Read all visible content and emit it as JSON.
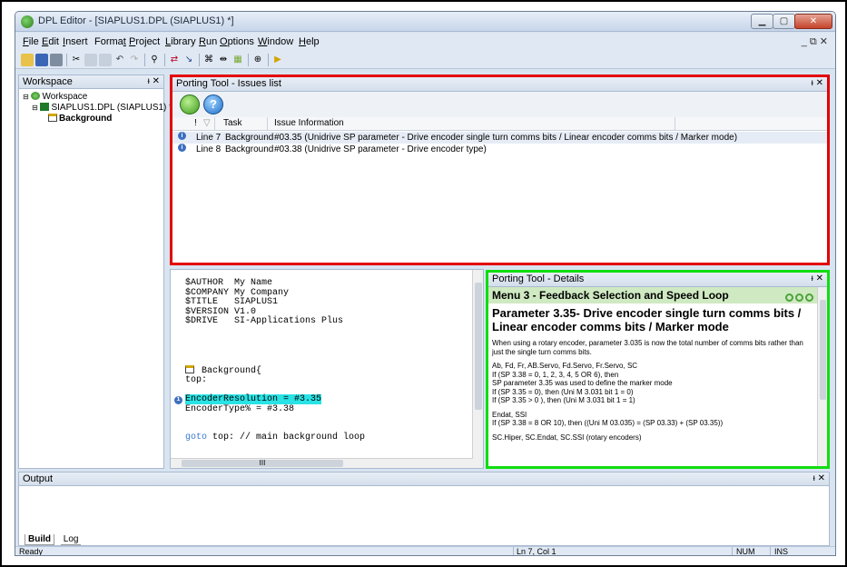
{
  "window": {
    "title": "DPL Editor - [SIAPLUS1.DPL (SIAPLUS1) *]"
  },
  "menu": [
    {
      "label": "File",
      "u": "F",
      "rest": "ile"
    },
    {
      "label": "Edit",
      "u": "E",
      "rest": "dit"
    },
    {
      "label": "Insert",
      "u": "I",
      "rest": "nsert"
    },
    {
      "label": "Format",
      "pre": "Forma",
      "u": "t",
      "rest": ""
    },
    {
      "label": "Project",
      "u": "P",
      "rest": "roject"
    },
    {
      "label": "Library",
      "u": "L",
      "rest": "ibrary"
    },
    {
      "label": "Run",
      "u": "R",
      "rest": "un"
    },
    {
      "label": "Options",
      "u": "O",
      "rest": "ptions"
    },
    {
      "label": "Window",
      "u": "W",
      "rest": "indow"
    },
    {
      "label": "Help",
      "u": "H",
      "rest": "elp"
    }
  ],
  "mdi_controls": "_ ⧉ ✕",
  "workspace": {
    "title": "Workspace",
    "pin": " ᵻ ✕",
    "tree": [
      "Workspace",
      "SIAPLUS1.DPL (SIAPLUS1) *",
      "Background"
    ]
  },
  "issues": {
    "title": "Porting Tool - Issues list",
    "columns": [
      "!",
      "Task",
      "Issue Information"
    ],
    "rows": [
      {
        "line": "Line 7",
        "task": "Background",
        "info": "#03.35 (Unidrive SP parameter - Drive encoder single turn comms bits / Linear encoder comms bits / Marker mode)"
      },
      {
        "line": "Line 8",
        "task": "Background",
        "info": "#03.38 (Unidrive SP parameter - Drive encoder type)"
      }
    ]
  },
  "editor": {
    "lines": [
      "$AUTHOR  My Name",
      "$COMPANY My Company",
      "$TITLE   SIAPLUS1",
      "$VERSION V1.0",
      "$DRIVE   SI-Applications Plus"
    ],
    "block": "Background{",
    "label": "top:",
    "hl_line": "EncoderResolution = #3.35",
    "line2": "EncoderType% = #3.38",
    "goto": "goto",
    "goto_rest": " top: // main background loop"
  },
  "details": {
    "title": "Porting Tool - Details",
    "band": "Menu 3 - Feedback Selection and Speed Loop",
    "heading": "Parameter 3.35- Drive encoder single turn comms bits / Linear encoder comms bits / Marker mode",
    "para1": "When using a rotary encoder, parameter 3.035 is now the total number of comms bits rather than just the single turn comms bits.",
    "para2": [
      "Ab, Fd, Fr, AB.Servo, Fd.Servo, Fr.Servo, SC",
      "If (SP 3.38 = 0, 1, 2, 3, 4, 5 OR 6), then",
      "SP parameter 3.35 was used to define the marker mode",
      "If (SP 3.35 = 0), then (Uni M 3.031 bit 1 = 0)",
      "If (SP 3.35 > 0 ), then (Uni M 3.031 bit 1 = 1)"
    ],
    "para3": [
      "Endat, SSI",
      "If (SP 3.38 = 8 OR 10), then ((Uni M 03.035) = (SP 03.33) + (SP 03.35))"
    ],
    "para4": "SC.Hiper, SC.Endat, SC.SSI (rotary encoders)"
  },
  "output": {
    "title": "Output",
    "tabs": [
      "Build",
      "Log"
    ]
  },
  "status": {
    "left": "Ready",
    "pos": "Ln 7, Col 1",
    "num": "NUM",
    "ins": "INS"
  }
}
